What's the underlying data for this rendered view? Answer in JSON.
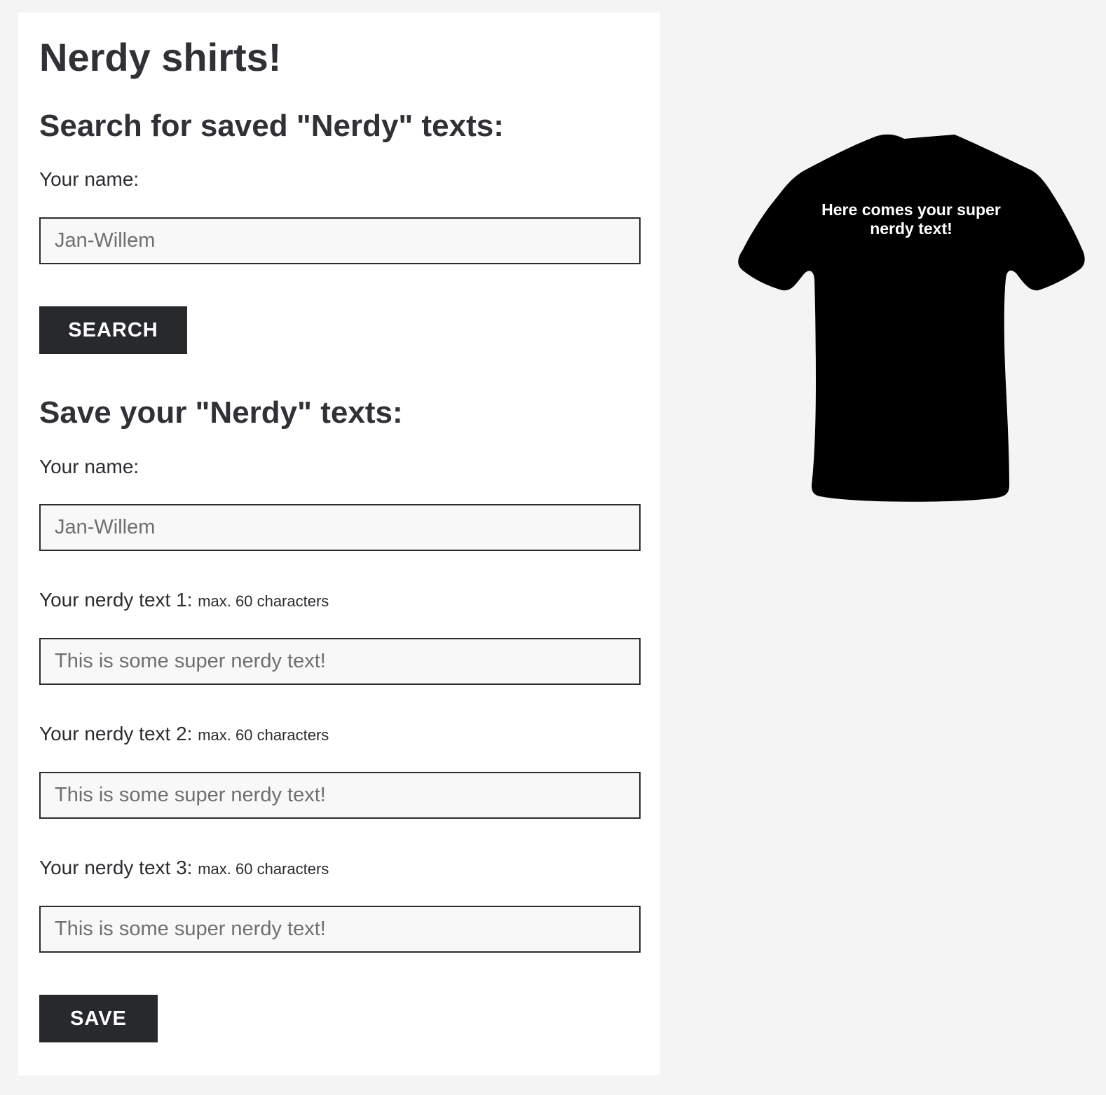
{
  "page": {
    "title": "Nerdy shirts!"
  },
  "search_section": {
    "heading": "Search for saved \"Nerdy\" texts:",
    "name_label": "Your name:",
    "name_placeholder": "Jan-Willem",
    "button_label": "Search"
  },
  "save_section": {
    "heading": "Save your \"Nerdy\" texts:",
    "name_label": "Your name:",
    "name_placeholder": "Jan-Willem",
    "texts": [
      {
        "label": "Your nerdy text 1:",
        "hint": "max. 60 characters",
        "placeholder": "This is some super nerdy text!"
      },
      {
        "label": "Your nerdy text 2:",
        "hint": "max. 60 characters",
        "placeholder": "This is some super nerdy text!"
      },
      {
        "label": "Your nerdy text 3:",
        "hint": "max. 60 characters",
        "placeholder": "This is some super nerdy text!"
      }
    ],
    "button_label": "Save"
  },
  "preview": {
    "shirt_text": "Here comes your super nerdy text!",
    "shirt_color": "#000000",
    "text_color": "#ffffff"
  }
}
